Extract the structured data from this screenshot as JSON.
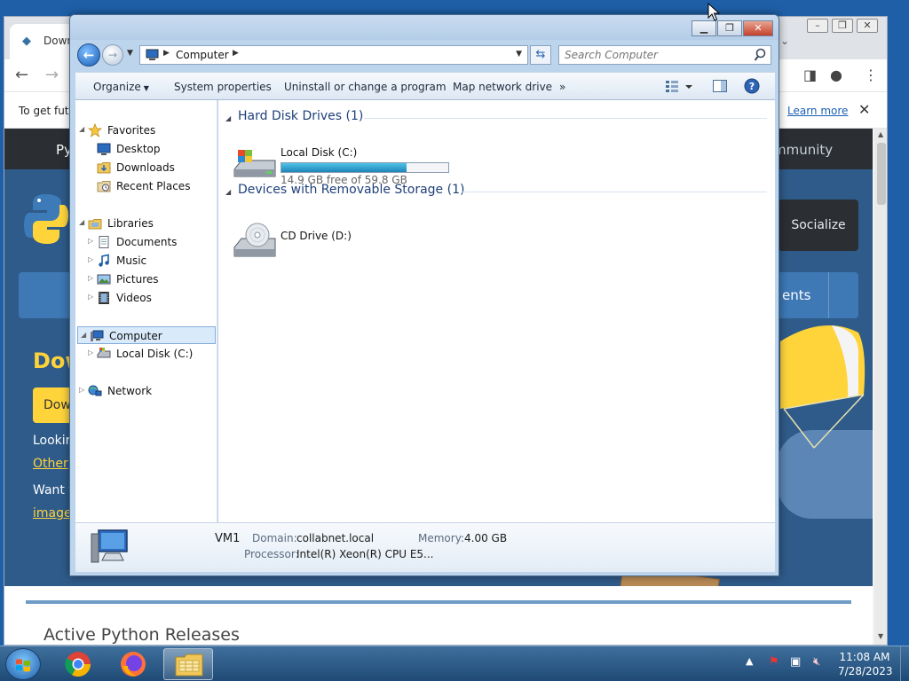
{
  "browser": {
    "tab_title": "Down",
    "infobar_text": "To get futu",
    "infobar_link": "Learn more",
    "nav_python": "Py",
    "nav_community": "mmunity",
    "socialize": "Socialize",
    "bandbar_text": "ents",
    "download_heading": "Dow",
    "download_button": "Dow",
    "text_looking": "Lookir",
    "text_other": "Other",
    "text_want": "Want t",
    "text_image": "image",
    "active_releases": "Active Python Releases"
  },
  "explorer": {
    "address": {
      "crumb": "Computer"
    },
    "search": {
      "placeholder": "Search Computer"
    },
    "commands": {
      "organize": "Organize",
      "system_properties": "System properties",
      "uninstall": "Uninstall or change a program",
      "map_drive": "Map network drive",
      "more": "»"
    },
    "nav": {
      "favorites": "Favorites",
      "desktop": "Desktop",
      "downloads": "Downloads",
      "recent_places": "Recent Places",
      "libraries": "Libraries",
      "documents": "Documents",
      "music": "Music",
      "pictures": "Pictures",
      "videos": "Videos",
      "computer": "Computer",
      "local_disk": "Local Disk (C:)",
      "network": "Network"
    },
    "groups": {
      "hdd_title": "Hard Disk Drives (1)",
      "removable_title": "Devices with Removable Storage (1)"
    },
    "drives": {
      "c_name": "Local Disk (C:)",
      "c_free": "14.9 GB free of 59.8 GB",
      "c_used_fraction": 0.75,
      "d_name": "CD Drive (D:)"
    },
    "details": {
      "computer_name": "VM1",
      "domain_label": "Domain:",
      "domain_value": "collabnet.local",
      "memory_label": "Memory:",
      "memory_value": "4.00 GB",
      "processor_label": "Processor:",
      "processor_value": "Intel(R) Xeon(R) CPU E5..."
    }
  },
  "taskbar": {
    "time": "11:08 AM",
    "date": "7/28/2023"
  },
  "colors": {
    "python_yellow": "#ffd43b",
    "python_blue": "#3672a4",
    "explorer_frame": "#bcd4ec",
    "usage_fill": "#1f85b8"
  }
}
